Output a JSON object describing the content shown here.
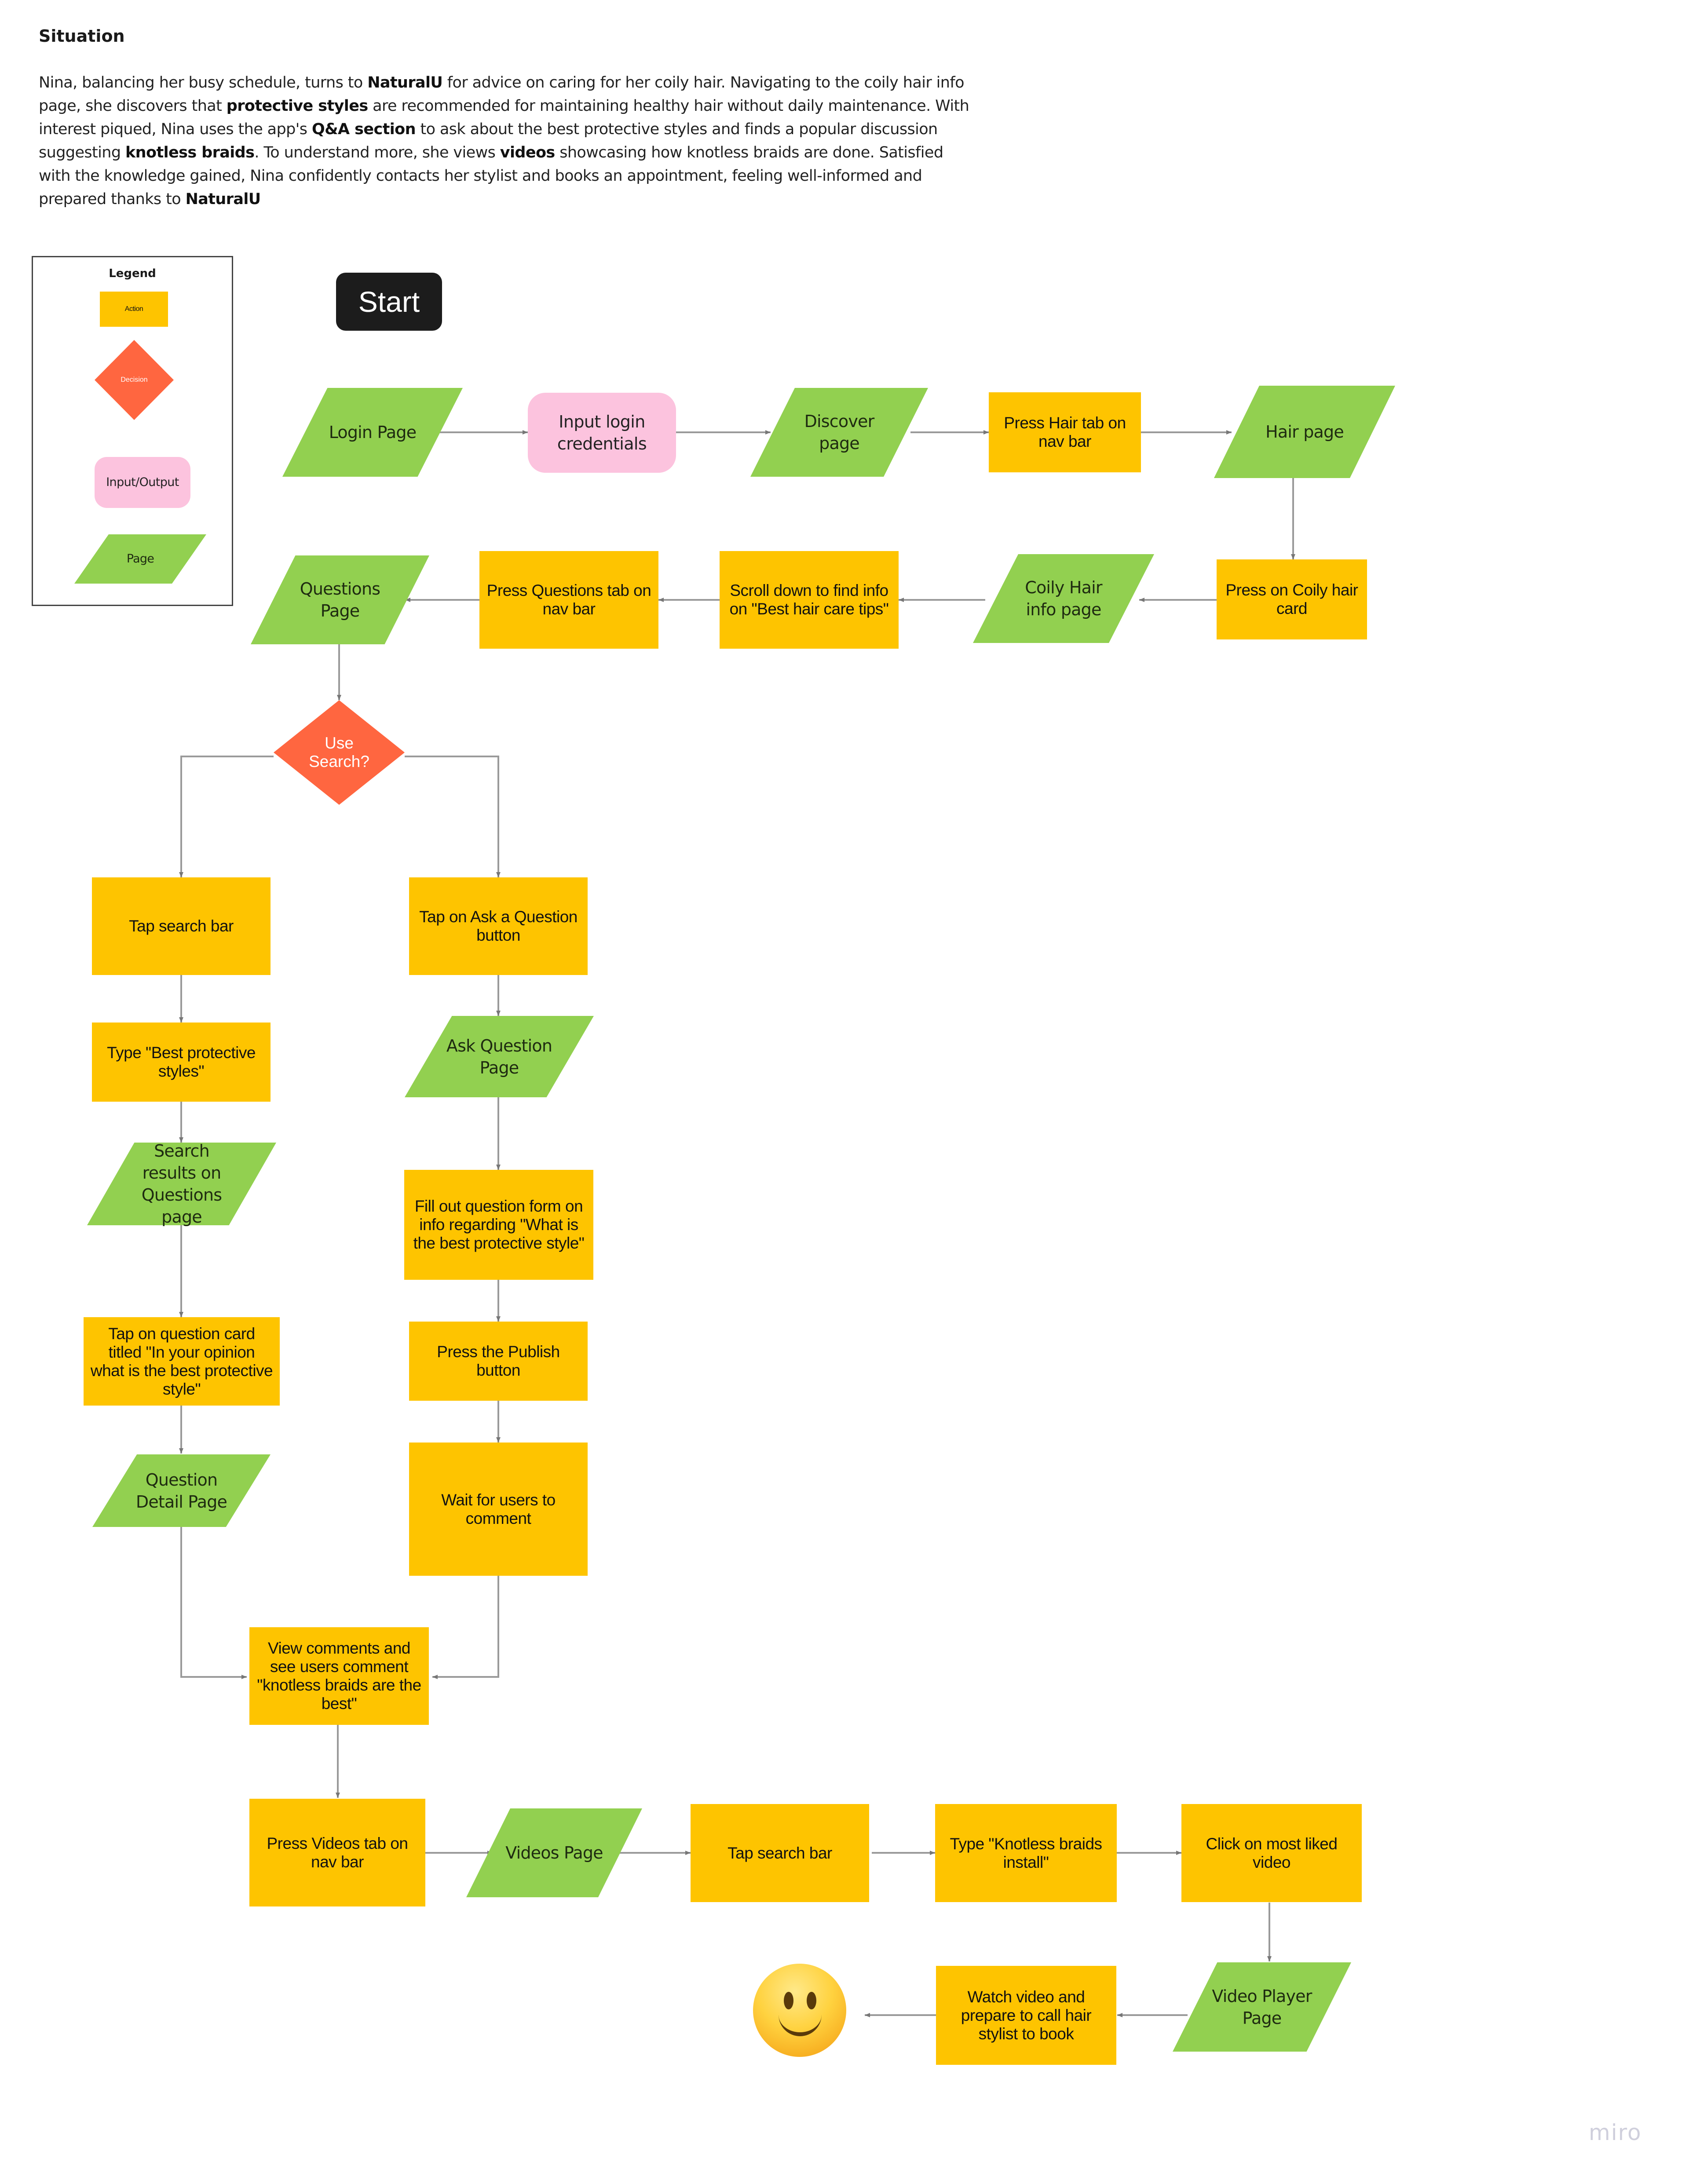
{
  "situation": {
    "title": "Situation",
    "segments": [
      {
        "t": "Nina, balancing her busy schedule, turns to ",
        "b": false
      },
      {
        "t": "NaturalU",
        "b": true
      },
      {
        "t": " for advice on caring for her coily hair. Navigating to the coily hair info page, she discovers that ",
        "b": false
      },
      {
        "t": "protective styles",
        "b": true
      },
      {
        "t": " are recommended for maintaining healthy hair without daily maintenance. With interest piqued, Nina uses the app's ",
        "b": false
      },
      {
        "t": "Q&A section",
        "b": true
      },
      {
        "t": " to ask about the best protective styles and finds a popular discussion suggesting ",
        "b": false
      },
      {
        "t": "knotless braids",
        "b": true
      },
      {
        "t": ". To understand more, she views ",
        "b": false
      },
      {
        "t": "videos",
        "b": true
      },
      {
        "t": " showcasing how knotless braids are done. Satisfied with the knowledge gained, Nina confidently contacts her stylist and books an appointment, feeling well-informed and prepared thanks to ",
        "b": false
      },
      {
        "t": "NaturalU",
        "b": true
      }
    ]
  },
  "legend": {
    "title": "Legend",
    "items": [
      {
        "type": "action",
        "label": "Action"
      },
      {
        "type": "decision",
        "label": "Decision"
      },
      {
        "type": "io",
        "label": "Input/Output"
      },
      {
        "type": "page",
        "label": "Page"
      }
    ]
  },
  "colors": {
    "action": "#fec400",
    "decision": "#ff6640",
    "io": "#fcc3de",
    "page": "#92d050",
    "start": "#1c1c1c",
    "connector": "#9a9a9a"
  },
  "start": {
    "label": "Start"
  },
  "nodes": {
    "login_page": {
      "type": "page",
      "label": "Login Page"
    },
    "input_login": {
      "type": "io",
      "label": "Input login credentials"
    },
    "discover_page": {
      "type": "page",
      "label": "Discover page"
    },
    "press_hair_tab": {
      "type": "action",
      "label": "Press Hair tab on nav bar"
    },
    "hair_page": {
      "type": "page",
      "label": "Hair page"
    },
    "press_coily_card": {
      "type": "action",
      "label": "Press on Coily hair card"
    },
    "coily_info_page": {
      "type": "page",
      "label": "Coily Hair info page"
    },
    "scroll_tips": {
      "type": "action",
      "label": "Scroll down to find info on \"Best hair care tips\""
    },
    "press_questions_tab": {
      "type": "action",
      "label": "Press Questions tab on nav bar"
    },
    "questions_page": {
      "type": "page",
      "label": "Questions Page"
    },
    "use_search": {
      "type": "decision",
      "label": "Use Search?"
    },
    "tap_search_bar_1": {
      "type": "action",
      "label": "Tap search bar"
    },
    "type_best_protective": {
      "type": "action",
      "label": "Type \"Best protective styles\""
    },
    "search_results_page": {
      "type": "page",
      "label": "Search results on Questions page"
    },
    "tap_question_card": {
      "type": "action",
      "label": "Tap on question card titled \"In your opinion what is the best protective style\""
    },
    "question_detail_page": {
      "type": "page",
      "label": "Question Detail Page"
    },
    "tap_ask_question": {
      "type": "action",
      "label": "Tap on Ask a Question button"
    },
    "ask_question_page": {
      "type": "page",
      "label": "Ask Question Page"
    },
    "fill_question_form": {
      "type": "action",
      "label": "Fill out question form on info regarding \"What is the best protective style\""
    },
    "press_publish": {
      "type": "action",
      "label": "Press the Publish button"
    },
    "wait_comments": {
      "type": "action",
      "label": "Wait for users to comment"
    },
    "view_comments": {
      "type": "action",
      "label": "View comments and see users comment \"knotless braids are the best\""
    },
    "press_videos_tab": {
      "type": "action",
      "label": "Press Videos tab on nav bar"
    },
    "videos_page": {
      "type": "page",
      "label": "Videos Page"
    },
    "tap_search_bar_2": {
      "type": "action",
      "label": "Tap search bar"
    },
    "type_knotless": {
      "type": "action",
      "label": "Type \"Knotless braids install\""
    },
    "click_most_liked": {
      "type": "action",
      "label": "Click on most liked video"
    },
    "video_player_page": {
      "type": "page",
      "label": "Video Player Page"
    },
    "watch_video": {
      "type": "action",
      "label": "Watch video and prepare to call hair stylist to book"
    },
    "end": {
      "type": "emoji",
      "label": "slightly-smiling-face"
    }
  },
  "watermark": "miro"
}
